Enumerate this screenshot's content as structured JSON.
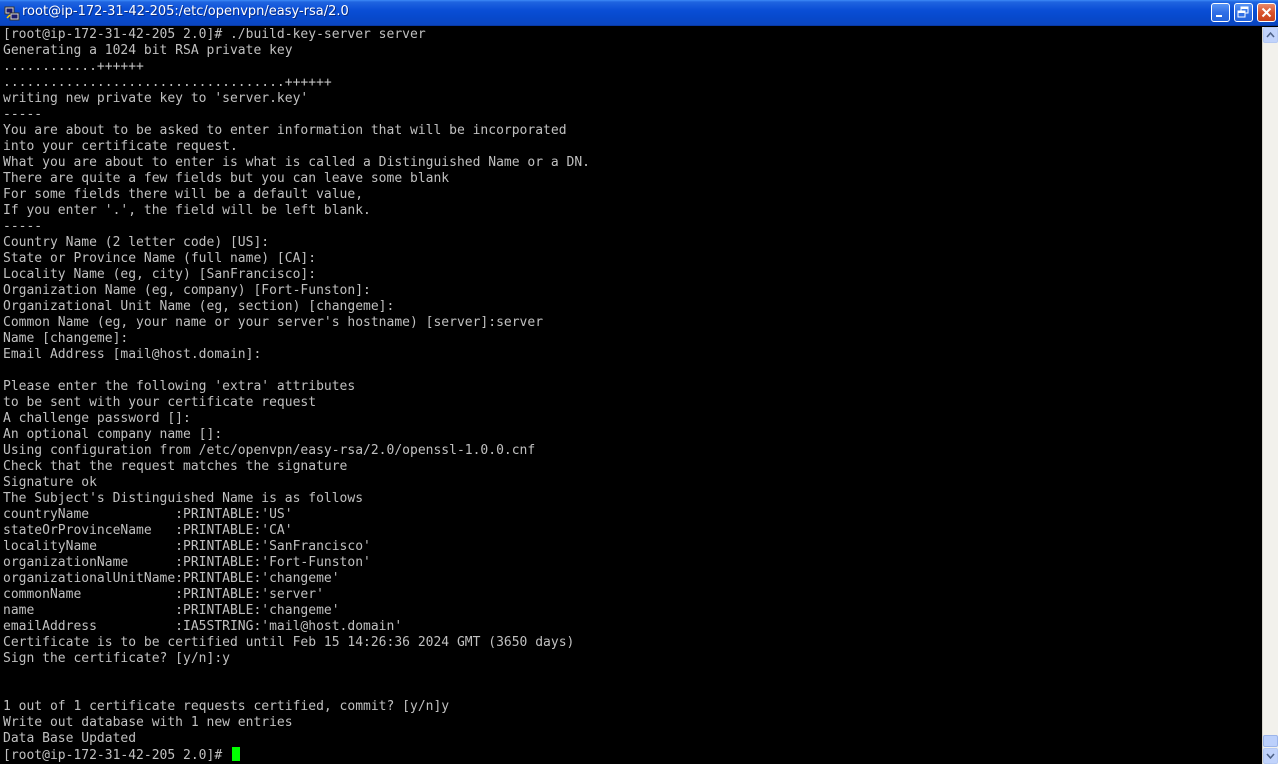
{
  "window": {
    "title": "root@ip-172-31-42-205:/etc/openvpn/easy-rsa/2.0"
  },
  "colors": {
    "titlebar": "#0a4ed6",
    "terminal_bg": "#000000",
    "terminal_fg": "#c0c0c0",
    "cursor": "#00ff00"
  },
  "terminal": {
    "lines": [
      "[root@ip-172-31-42-205 2.0]# ./build-key-server server",
      "Generating a 1024 bit RSA private key",
      "............++++++",
      "....................................++++++",
      "writing new private key to 'server.key'",
      "-----",
      "You are about to be asked to enter information that will be incorporated",
      "into your certificate request.",
      "What you are about to enter is what is called a Distinguished Name or a DN.",
      "There are quite a few fields but you can leave some blank",
      "For some fields there will be a default value,",
      "If you enter '.', the field will be left blank.",
      "-----",
      "Country Name (2 letter code) [US]:",
      "State or Province Name (full name) [CA]:",
      "Locality Name (eg, city) [SanFrancisco]:",
      "Organization Name (eg, company) [Fort-Funston]:",
      "Organizational Unit Name (eg, section) [changeme]:",
      "Common Name (eg, your name or your server's hostname) [server]:server",
      "Name [changeme]:",
      "Email Address [mail@host.domain]:",
      "",
      "Please enter the following 'extra' attributes",
      "to be sent with your certificate request",
      "A challenge password []:",
      "An optional company name []:",
      "Using configuration from /etc/openvpn/easy-rsa/2.0/openssl-1.0.0.cnf",
      "Check that the request matches the signature",
      "Signature ok",
      "The Subject's Distinguished Name is as follows",
      "countryName           :PRINTABLE:'US'",
      "stateOrProvinceName   :PRINTABLE:'CA'",
      "localityName          :PRINTABLE:'SanFrancisco'",
      "organizationName      :PRINTABLE:'Fort-Funston'",
      "organizationalUnitName:PRINTABLE:'changeme'",
      "commonName            :PRINTABLE:'server'",
      "name                  :PRINTABLE:'changeme'",
      "emailAddress          :IA5STRING:'mail@host.domain'",
      "Certificate is to be certified until Feb 15 14:26:36 2024 GMT (3650 days)",
      "Sign the certificate? [y/n]:y",
      "",
      "",
      "1 out of 1 certificate requests certified, commit? [y/n]y",
      "Write out database with 1 new entries",
      "Data Base Updated"
    ],
    "prompt": "[root@ip-172-31-42-205 2.0]# "
  }
}
